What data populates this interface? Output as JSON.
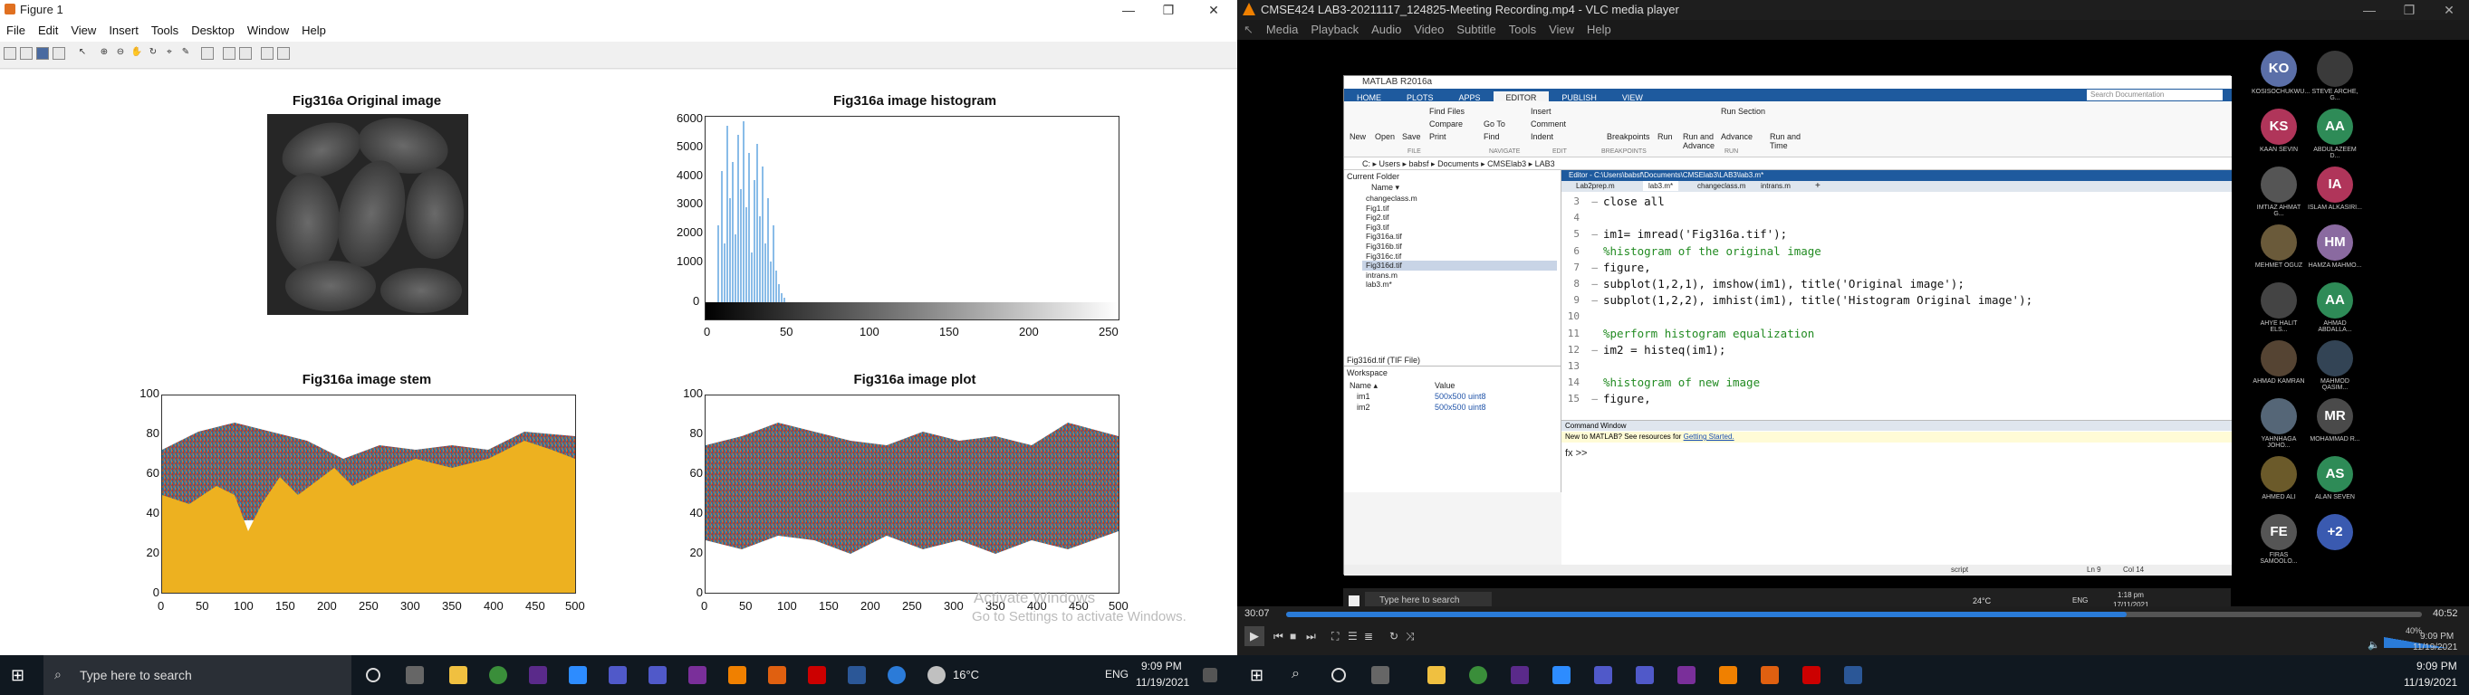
{
  "figure": {
    "title": "Figure 1",
    "menu": [
      "File",
      "Edit",
      "View",
      "Insert",
      "Tools",
      "Desktop",
      "Window",
      "Help"
    ],
    "plots": {
      "original": {
        "title": "Fig316a Original image"
      },
      "histogram": {
        "title": "Fig316a image histogram",
        "yticks": [
          "6000",
          "5000",
          "4000",
          "3000",
          "2000",
          "1000",
          "0"
        ],
        "xticks": [
          "0",
          "50",
          "100",
          "150",
          "200",
          "250"
        ]
      },
      "stem": {
        "title": "Fig316a image stem",
        "yticks": [
          "100",
          "80",
          "60",
          "40",
          "20",
          "0"
        ],
        "xticks": [
          "0",
          "50",
          "100",
          "150",
          "200",
          "250",
          "300",
          "350",
          "400",
          "450",
          "500"
        ]
      },
      "plot": {
        "title": "Fig316a image plot",
        "yticks": [
          "100",
          "80",
          "60",
          "40",
          "20",
          "0"
        ],
        "xticks": [
          "0",
          "50",
          "100",
          "150",
          "200",
          "250",
          "300",
          "350",
          "400",
          "450",
          "500"
        ]
      }
    },
    "watermark": {
      "line1": "Activate Windows",
      "line2": "Go to Settings to activate Windows."
    }
  },
  "vlc": {
    "title": "CMSE424 LAB3-20211117_124825-Meeting Recording.mp4 - VLC media player",
    "menu": [
      "Media",
      "Playback",
      "Audio",
      "Video",
      "Subtitle",
      "Tools",
      "View",
      "Help"
    ],
    "time_elapsed": "30:07",
    "time_total": "40:52",
    "volume": "40%",
    "progress": 0.74
  },
  "matlab": {
    "title": "MATLAB R2016a",
    "tabs": [
      "HOME",
      "PLOTS",
      "APPS",
      "EDITOR",
      "PUBLISH",
      "VIEW"
    ],
    "search_placeholder": "Search Documentation",
    "ribbon": {
      "new": "New",
      "open": "Open",
      "save": "Save",
      "find_files": "Find Files",
      "compare": "Compare",
      "print": "Print",
      "insert": "Insert",
      "comment": "Comment",
      "indent": "Indent",
      "go_to": "Go To",
      "find": "Find",
      "breakpoints": "Breakpoints",
      "run": "Run",
      "run_and_advance": "Run and Advance",
      "run_section": "Run Section",
      "advance": "Advance",
      "run_and_time": "Run and Time",
      "sections": [
        "FILE",
        "NAVIGATE",
        "EDIT",
        "BREAKPOINTS",
        "RUN"
      ]
    },
    "path": "C: ▸ Users ▸ babsf ▸ Documents ▸ CMSElab3 ▸ LAB3",
    "current_folder": {
      "header": "Current Folder",
      "col_name": "Name ▾",
      "files": [
        "changeclass.m",
        "Fig1.tif",
        "Fig2.tif",
        "Fig3.tif",
        "Fig316a.tif",
        "Fig316b.tif",
        "Fig316c.tif",
        "Fig316d.tif",
        "intrans.m",
        "lab3.m*"
      ],
      "selected": "Fig316d.tif (TIF File)"
    },
    "workspace": {
      "header": "Workspace",
      "cols": [
        "Name ▴",
        "Value"
      ],
      "rows": [
        [
          "im1",
          "500x500 uint8"
        ],
        [
          "im2",
          "500x500 uint8"
        ]
      ]
    },
    "editor": {
      "path": "Editor - C:\\Users\\babsf\\Documents\\CMSElab3\\LAB3\\lab3.m*",
      "tabs": [
        "Lab2prep.m",
        "lab3.m*",
        "changeclass.m",
        "intrans.m"
      ],
      "lines": [
        {
          "n": "3",
          "dash": "—",
          "code": "close all"
        },
        {
          "n": "4",
          "dash": "",
          "code": ""
        },
        {
          "n": "5",
          "dash": "—",
          "code": "im1= imread('Fig316a.tif');"
        },
        {
          "n": "6",
          "dash": "",
          "code": "%histogram of the original image"
        },
        {
          "n": "7",
          "dash": "—",
          "code": "figure,"
        },
        {
          "n": "8",
          "dash": "—",
          "code": "subplot(1,2,1), imshow(im1), title('Original image');"
        },
        {
          "n": "9",
          "dash": "—",
          "code": "subplot(1,2,2), imhist(im1), title('Histogram Original image');"
        },
        {
          "n": "10",
          "dash": "",
          "code": ""
        },
        {
          "n": "11",
          "dash": "",
          "code": "%perform histogram equalization"
        },
        {
          "n": "12",
          "dash": "—",
          "code": "im2 = histeq(im1);"
        },
        {
          "n": "13",
          "dash": "",
          "code": ""
        },
        {
          "n": "14",
          "dash": "",
          "code": "%histogram of new image"
        },
        {
          "n": "15",
          "dash": "—",
          "code": "figure,"
        }
      ]
    },
    "command_window": {
      "header": "Command Window",
      "notice": "New to MATLAB? See resources for",
      "link": "Getting Started.",
      "prompt": "fx >>"
    },
    "status": {
      "script": "script",
      "ln": "Ln 9",
      "col": "Col 14"
    },
    "inner_taskbar": {
      "search": "Type here to search",
      "temp": "24°C",
      "lang": "ENG",
      "time": "1:18 pm",
      "date": "17/11/2021"
    }
  },
  "participants": [
    {
      "initials": "KO",
      "name": "KOSISOCHUKWU...",
      "color": "#5b6fa8"
    },
    {
      "initials": "",
      "name": "STEVE ARCHE, G...",
      "color": "#3a3a3a"
    },
    {
      "initials": "KS",
      "name": "KAAN SEVIN",
      "color": "#b0355a"
    },
    {
      "initials": "AA",
      "name": "ABDULAZEEM D...",
      "color": "#2e8b57"
    },
    {
      "initials": "",
      "name": "IMTIAZ AHMAT G...",
      "color": "#555"
    },
    {
      "initials": "IA",
      "name": "ISLAM ALKASIRI...",
      "color": "#b0355a"
    },
    {
      "initials": "",
      "name": "MEHMET OGUZ",
      "color": "#6a5a3a"
    },
    {
      "initials": "HM",
      "name": "HAMZA MAHMO...",
      "color": "#8a6aa0"
    },
    {
      "initials": "",
      "name": "AHYE HALIT ELS...",
      "color": "#444"
    },
    {
      "initials": "AA",
      "name": "AHMAD ABDALLA...",
      "color": "#2e8b57"
    },
    {
      "initials": "",
      "name": "AHMAD KAMRAN",
      "color": "#554433"
    },
    {
      "initials": "",
      "name": "MAHMOD QASIM...",
      "color": "#334455"
    },
    {
      "initials": "",
      "name": "YAHNHAGA JOHO...",
      "color": "#556677"
    },
    {
      "initials": "MR",
      "name": "MOHAMMAD R...",
      "color": "#4a4a4a"
    },
    {
      "initials": "",
      "name": "AHMED ALI",
      "color": "#6b5a2a"
    },
    {
      "initials": "AS",
      "name": "ALAN SEVEN",
      "color": "#2e8b57"
    },
    {
      "initials": "FE",
      "name": "FIRAS SAMOOLO...",
      "color": "#555"
    },
    {
      "initials": "+2",
      "name": "",
      "color": "#3a5ab0"
    }
  ],
  "taskbar_left": {
    "search": "Type here to search",
    "temp": "16°C",
    "lang": "ENG",
    "time": "9:09 PM",
    "date": "11/19/2021"
  },
  "taskbar_right": {
    "time": "9:09 PM",
    "date": "11/19/2021"
  },
  "vlc_clock": {
    "time": "9:09 PM",
    "date": "11/19/2021"
  }
}
